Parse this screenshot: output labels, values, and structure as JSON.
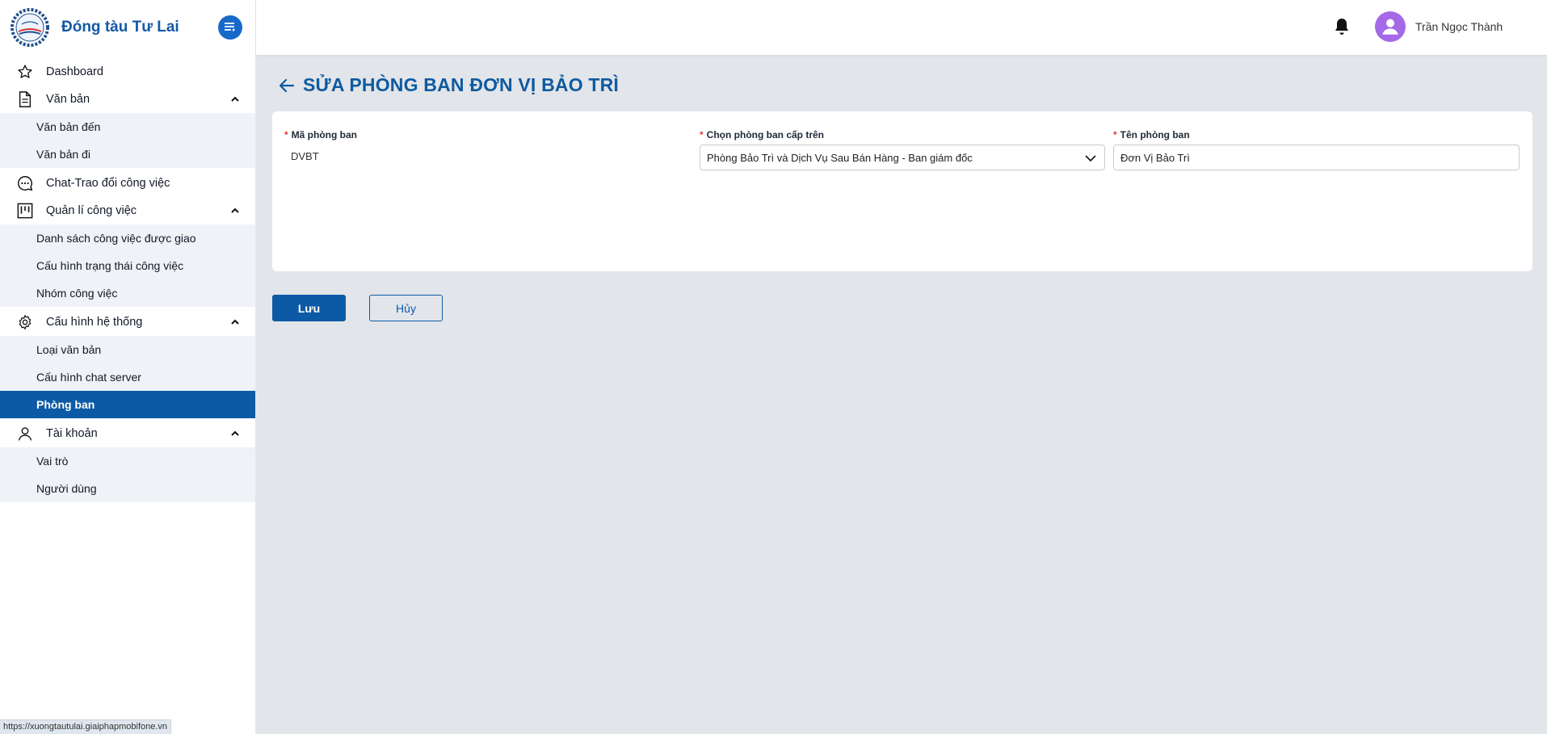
{
  "brand": {
    "name": "Đóng tàu Tư Lai"
  },
  "sidebar": {
    "dashboard": "Dashboard",
    "van_ban": {
      "label": "Văn bản",
      "items": [
        "Văn bản đến",
        "Văn bản đi"
      ]
    },
    "chat": "Chat-Trao đổi công việc",
    "quan_li": {
      "label": "Quản lí công việc",
      "items": [
        "Danh sách công việc được giao",
        "Cấu hình trạng thái công việc",
        "Nhóm công việc"
      ]
    },
    "cau_hinh": {
      "label": "Cấu hình hệ thống",
      "items": [
        "Loại văn bản",
        "Cấu hình chat server",
        "Phòng ban"
      ],
      "active_index": 2
    },
    "tai_khoan": {
      "label": "Tài khoản",
      "items": [
        "Vai trò",
        "Người dùng"
      ]
    }
  },
  "header": {
    "user_name": "Trần Ngọc Thành"
  },
  "page": {
    "title": "SỬA PHÒNG BAN ĐƠN VỊ BẢO TRÌ"
  },
  "form": {
    "ma_phong_ban": {
      "label": "Mã phòng ban",
      "value": "DVBT"
    },
    "phong_ban_cap_tren": {
      "label": "Chọn phòng ban cấp trên",
      "value": "Phòng Bảo Trì và Dịch Vụ Sau Bán Hàng - Ban giám đốc"
    },
    "ten_phong_ban": {
      "label": "Tên phòng ban",
      "value": "Đơn Vị Bảo Trì"
    },
    "required_mark": "*"
  },
  "actions": {
    "save": "Lưu",
    "cancel": "Hủy"
  },
  "status_bar": {
    "url": "https://xuongtautulai.giaiphapmobifone.vn"
  },
  "colors": {
    "primary": "#0c5aa6",
    "accent": "#1769c9",
    "avatar": "#a569e8",
    "required": "#e53935"
  }
}
